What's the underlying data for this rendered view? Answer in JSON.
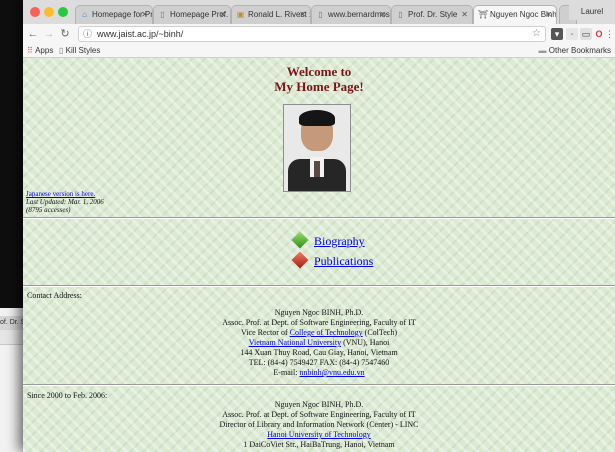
{
  "background_window": {
    "tab_label": "of. Dr. St"
  },
  "browser": {
    "tabs": [
      {
        "label": "Homepage for Prof",
        "icon": "home-icon",
        "active": false
      },
      {
        "label": "Homepage Prof. H",
        "icon": "document-icon",
        "active": false
      },
      {
        "label": "Ronald L. Rivest :",
        "icon": "page-icon",
        "active": false
      },
      {
        "label": "www.bernardmoss",
        "icon": "document-icon",
        "active": false
      },
      {
        "label": "Prof. Dr. Style",
        "icon": "document-icon",
        "active": false
      },
      {
        "label": "Nguyen Ngoc Binh",
        "icon": "university-icon",
        "active": true
      }
    ],
    "profile_name": "Laurel",
    "address": "www.jaist.ac.jp/~binh/",
    "bookmarks": {
      "apps": "Apps",
      "kill_styles": "Kill Styles",
      "other": "Other Bookmarks"
    },
    "colors": {
      "tab_bar": "#dcdcdc",
      "toolbar": "#f6f6f6",
      "page_bg": "#dcead4",
      "link": "#0000ee",
      "heading": "#7a1515"
    }
  },
  "page": {
    "welcome_line1": "Welcome to",
    "welcome_line2": "My Home Page!",
    "japanese_link": "Japanese version is here.",
    "last_updated": "Last Updated: Mar. 1, 2006",
    "accesses": "(8795 accesses)",
    "nav": {
      "biography": "Biography",
      "publications": "Publications"
    },
    "contact": {
      "label": "Contact Address:",
      "name": "Nguyen Ngoc BINH, Ph.D.",
      "position": "Assoc. Prof. at Dept. of Software Engineering, Faculty of IT",
      "vice_rector_prefix": "Vice Rector of ",
      "college_link": "College of Technology",
      "vice_rector_suffix": " (ColTech)",
      "university_link": "Vietnam National University",
      "university_suffix": " (VNU), Hanoi",
      "street": "144 Xuan Thuy Road, Cau Giay, Hanoi, Vietnam",
      "phone": "TEL: (84-4) 7549427 FAX: (84-4) 7547460",
      "email_prefix": "E-mail: ",
      "email": "nnbinh@vnu.edu.vn"
    },
    "previous": {
      "label": "Since 2000 to Feb. 2006:",
      "name": "Nguyen Ngoc BINH, Ph.D.",
      "position": "Assoc. Prof. at Dept. of Software Engineering, Faculty of IT",
      "director": "Director of Library and Information Network (Center) - LINC",
      "university_link": "Hanoi University of Technology",
      "street": "1 DaiCoViet Str., HaiBaTrung, Hanoi, Vietnam"
    }
  }
}
